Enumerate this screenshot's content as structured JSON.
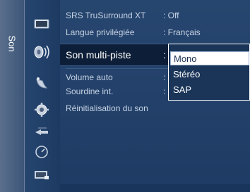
{
  "section_tab": {
    "label": "Son"
  },
  "icons": [
    "picture-icon",
    "sound-icon",
    "channel-icon",
    "setup-icon",
    "input-icon",
    "application-icon",
    "support-icon"
  ],
  "menu": {
    "items": [
      {
        "label": "SRS TruSurround XT",
        "value": ": Off"
      },
      {
        "label": "Langue privilégiée",
        "value": ": Français"
      },
      {
        "label": "Son multi-piste",
        "value": ":",
        "selected": true
      },
      {
        "label": "Volume auto",
        "value": ":"
      },
      {
        "label": "Sourdine int.",
        "value": ":"
      },
      {
        "label": "Réinitialisation du son",
        "value": ""
      }
    ]
  },
  "dropdown": {
    "options": [
      "Mono",
      "Stéréo",
      "SAP"
    ],
    "selected": "Mono"
  },
  "colors": {
    "background": "#203e6a",
    "highlight_row": "#0d1f38",
    "text": "#c7d3e4",
    "selected_text": "#ffffff"
  }
}
